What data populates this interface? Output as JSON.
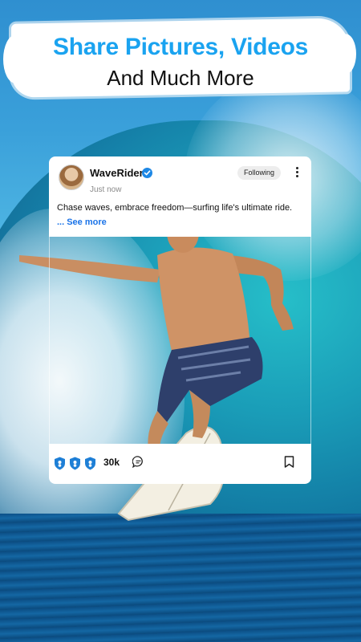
{
  "headline": {
    "line1": "Share Pictures, Videos",
    "line2": "And Much More",
    "accent_color": "#1aa3f0"
  },
  "post": {
    "username": "WaveRider",
    "verified": true,
    "timestamp": "Just now",
    "follow_label": "Following",
    "caption": "Chase waves, embrace freedom—surfing life's ultimate ride.",
    "see_more_label": "... See more",
    "like_count": "30k",
    "icons": {
      "avatar": "avatar",
      "verified": "verified-badge-icon",
      "more": "more-vertical-icon",
      "reactions": [
        "shield-badge-icon",
        "shield-badge-icon",
        "shield-badge-icon"
      ],
      "comment": "comment-icon",
      "bookmark": "bookmark-icon"
    }
  }
}
